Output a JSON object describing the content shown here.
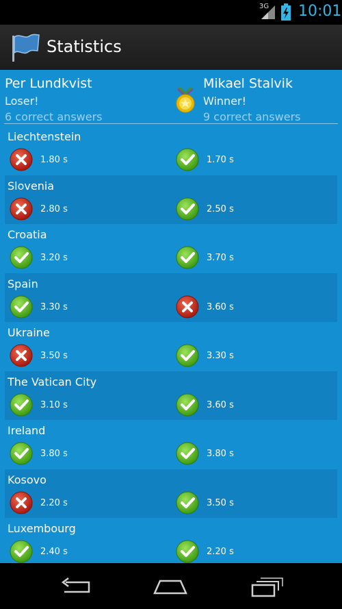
{
  "status_bar": {
    "network": "3G",
    "time": "10:01"
  },
  "action_bar": {
    "title": "Statistics"
  },
  "players": [
    {
      "name": "Per Lundkvist",
      "status": "Loser!",
      "correct": "6 correct answers"
    },
    {
      "name": "Mikael Stalvik",
      "status": "Winner!",
      "correct": "9 correct answers"
    }
  ],
  "rows": [
    {
      "country": "Liechtenstein",
      "p1": {
        "result": "wrong",
        "time": "1.80 s"
      },
      "p2": {
        "result": "correct",
        "time": "1.70 s"
      }
    },
    {
      "country": "Slovenia",
      "p1": {
        "result": "wrong",
        "time": "2.80 s"
      },
      "p2": {
        "result": "correct",
        "time": "2.50 s"
      }
    },
    {
      "country": "Croatia",
      "p1": {
        "result": "correct",
        "time": "3.20 s"
      },
      "p2": {
        "result": "correct",
        "time": "3.70 s"
      }
    },
    {
      "country": "Spain",
      "p1": {
        "result": "correct",
        "time": "3.30 s"
      },
      "p2": {
        "result": "wrong",
        "time": "3.60 s"
      }
    },
    {
      "country": "Ukraine",
      "p1": {
        "result": "wrong",
        "time": "3.50 s"
      },
      "p2": {
        "result": "correct",
        "time": "3.30 s"
      }
    },
    {
      "country": "The Vatican City",
      "p1": {
        "result": "correct",
        "time": "3.10 s"
      },
      "p2": {
        "result": "correct",
        "time": "3.60 s"
      }
    },
    {
      "country": "Ireland",
      "p1": {
        "result": "correct",
        "time": "3.80 s"
      },
      "p2": {
        "result": "correct",
        "time": "3.80 s"
      }
    },
    {
      "country": "Kosovo",
      "p1": {
        "result": "wrong",
        "time": "2.20 s"
      },
      "p2": {
        "result": "correct",
        "time": "3.50 s"
      }
    },
    {
      "country": "Luxembourg",
      "p1": {
        "result": "correct",
        "time": "2.40 s"
      },
      "p2": {
        "result": "correct",
        "time": "2.20 s"
      }
    }
  ],
  "icons": {
    "correct": "check-icon",
    "wrong": "cross-icon",
    "winner": "medal-icon",
    "app": "flag-icon"
  },
  "colors": {
    "accent": "#33b5e5",
    "background": "#148fd1",
    "row_alt": "#1181c2",
    "correct": "#5ab51e",
    "wrong": "#c8281c"
  }
}
